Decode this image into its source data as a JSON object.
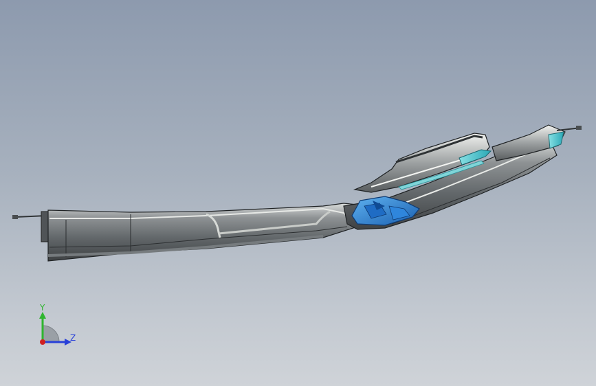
{
  "viewport": {
    "background_top": "#8d9aae",
    "background_bottom": "#cfd3d8",
    "model": {
      "body_color": "#6f7478",
      "highlight_color": "#d8dcdc",
      "accent_blue": "#2a84d8",
      "accent_cyan": "#5cc8d0"
    }
  },
  "triad": {
    "y_label": "Y",
    "z_label": "Z",
    "y_color": "#2fb52f",
    "z_color": "#2840d8",
    "origin_color": "#d02020"
  }
}
